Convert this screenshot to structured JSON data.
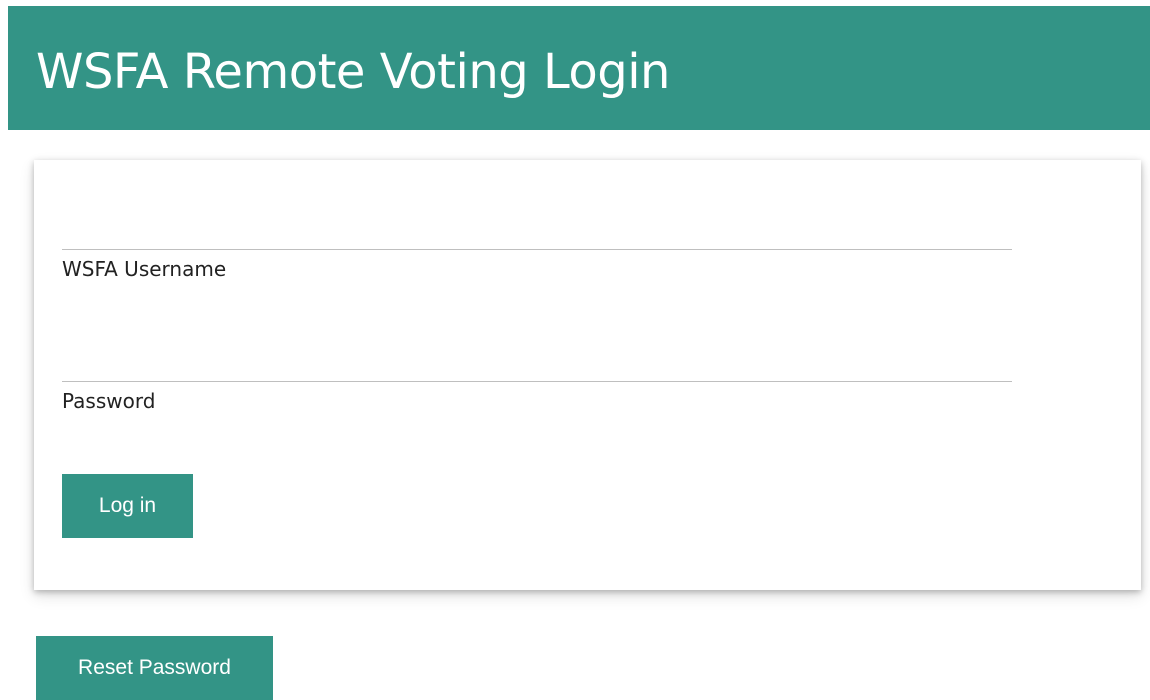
{
  "header": {
    "title": "WSFA Remote Voting Login"
  },
  "login_form": {
    "username": {
      "label": "WSFA Username",
      "value": "",
      "placeholder": ""
    },
    "password": {
      "label": "Password",
      "value": "",
      "placeholder": ""
    },
    "login_button_label": "Log in"
  },
  "reset_button_label": "Reset Password",
  "colors": {
    "brand": "#339486",
    "header_text": "#ffffff",
    "button_text": "#ffffff"
  }
}
